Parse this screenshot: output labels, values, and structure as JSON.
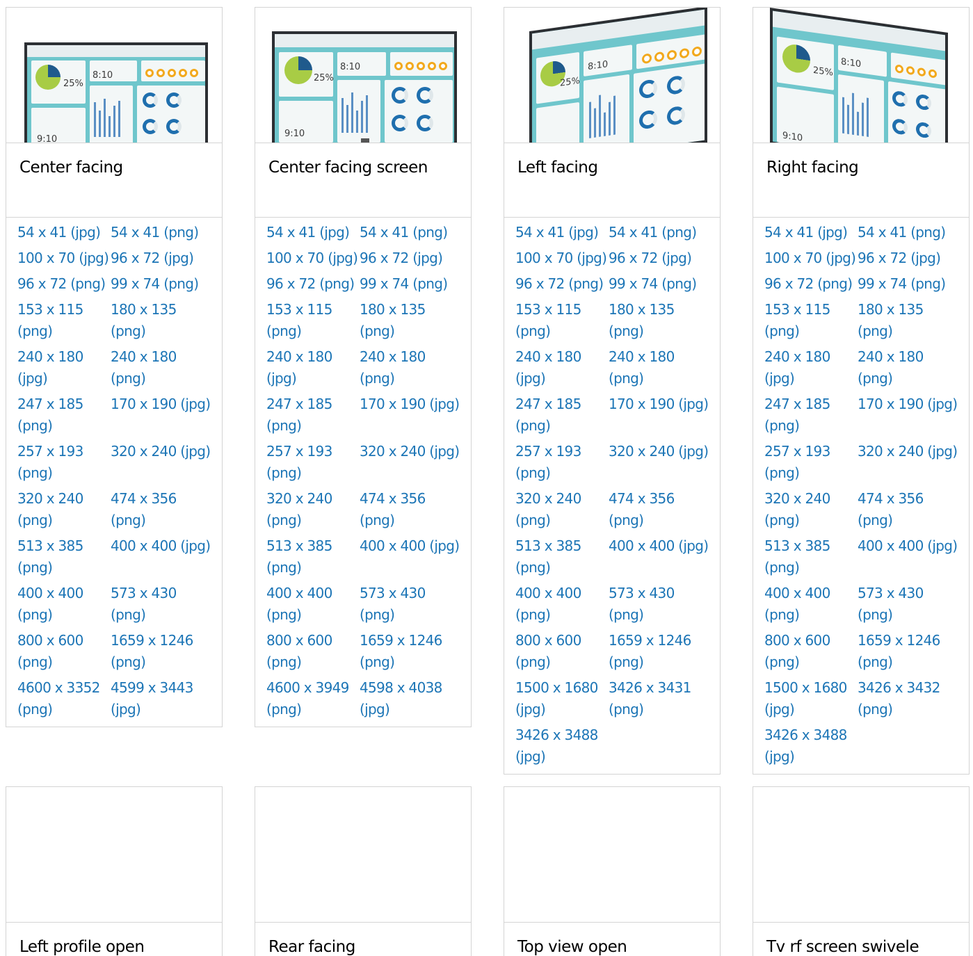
{
  "colors": {
    "link": "#1c75b6",
    "border": "#d4d4d4",
    "screen": "#6fc6cc"
  },
  "cards": [
    {
      "title": "Center facing",
      "image": "monitor-center",
      "links": [
        "54 x 41 (jpg)",
        "54 x 41 (png)",
        "100 x 70 (jpg)",
        "96 x 72 (jpg)",
        "96 x 72 (png)",
        "99 x 74 (png)",
        "153 x 115 (png)",
        "180 x 135 (png)",
        "240 x 180 (jpg)",
        "240 x 180 (png)",
        "247 x 185 (png)",
        "170 x 190 (jpg)",
        "257 x 193 (png)",
        "320 x 240 (jpg)",
        "320 x 240 (png)",
        "474 x 356 (png)",
        "513 x 385 (png)",
        "400 x 400 (jpg)",
        "400 x 400 (png)",
        "573 x 430 (png)",
        "800 x 600 (png)",
        "1659 x 1246 (png)",
        "4600 x 3352 (png)",
        "4599 x 3443 (jpg)"
      ]
    },
    {
      "title": "Center facing screen",
      "image": "monitor-center-screen",
      "links": [
        "54 x 41 (jpg)",
        "54 x 41 (png)",
        "100 x 70 (jpg)",
        "96 x 72 (jpg)",
        "96 x 72 (png)",
        "99 x 74 (png)",
        "153 x 115 (png)",
        "180 x 135 (png)",
        "240 x 180 (jpg)",
        "240 x 180 (png)",
        "247 x 185 (png)",
        "170 x 190 (jpg)",
        "257 x 193 (png)",
        "320 x 240 (jpg)",
        "320 x 240 (png)",
        "474 x 356 (png)",
        "513 x 385 (png)",
        "400 x 400 (jpg)",
        "400 x 400 (png)",
        "573 x 430 (png)",
        "800 x 600 (png)",
        "1659 x 1246 (png)",
        "4600 x 3949 (png)",
        "4598 x 4038 (jpg)"
      ]
    },
    {
      "title": "Left facing",
      "image": "monitor-left",
      "links": [
        "54 x 41 (jpg)",
        "54 x 41 (png)",
        "100 x 70 (jpg)",
        "96 x 72 (jpg)",
        "96 x 72 (png)",
        "99 x 74 (png)",
        "153 x 115 (png)",
        "180 x 135 (png)",
        "240 x 180 (jpg)",
        "240 x 180 (png)",
        "247 x 185 (png)",
        "170 x 190 (jpg)",
        "257 x 193 (png)",
        "320 x 240 (jpg)",
        "320 x 240 (png)",
        "474 x 356 (png)",
        "513 x 385 (png)",
        "400 x 400 (jpg)",
        "400 x 400 (png)",
        "573 x 430 (png)",
        "800 x 600 (png)",
        "1659 x 1246 (png)",
        "1500 x 1680 (jpg)",
        "3426 x 3431 (png)",
        "3426 x 3488 (jpg)"
      ]
    },
    {
      "title": "Right facing",
      "image": "monitor-right",
      "links": [
        "54 x 41 (jpg)",
        "54 x 41 (png)",
        "100 x 70 (jpg)",
        "96 x 72 (jpg)",
        "96 x 72 (png)",
        "99 x 74 (png)",
        "153 x 115 (png)",
        "180 x 135 (png)",
        "240 x 180 (jpg)",
        "240 x 180 (png)",
        "247 x 185 (png)",
        "170 x 190 (jpg)",
        "257 x 193 (png)",
        "320 x 240 (jpg)",
        "320 x 240 (png)",
        "474 x 356 (png)",
        "513 x 385 (png)",
        "400 x 400 (jpg)",
        "400 x 400 (png)",
        "573 x 430 (png)",
        "800 x 600 (png)",
        "1659 x 1246 (png)",
        "1500 x 1680 (jpg)",
        "3426 x 3432 (png)",
        "3426 x 3488 (jpg)"
      ]
    },
    {
      "title": "Left profile open",
      "image": "blank",
      "links": []
    },
    {
      "title": "Rear facing",
      "image": "blank",
      "links": []
    },
    {
      "title": "Top view open",
      "image": "blank",
      "links": []
    },
    {
      "title": "Tv rf screen swivele",
      "image": "blank",
      "links": []
    }
  ],
  "screen_text": {
    "pie_pct": "25%",
    "stat": "8:10",
    "stat2": "9:10"
  }
}
